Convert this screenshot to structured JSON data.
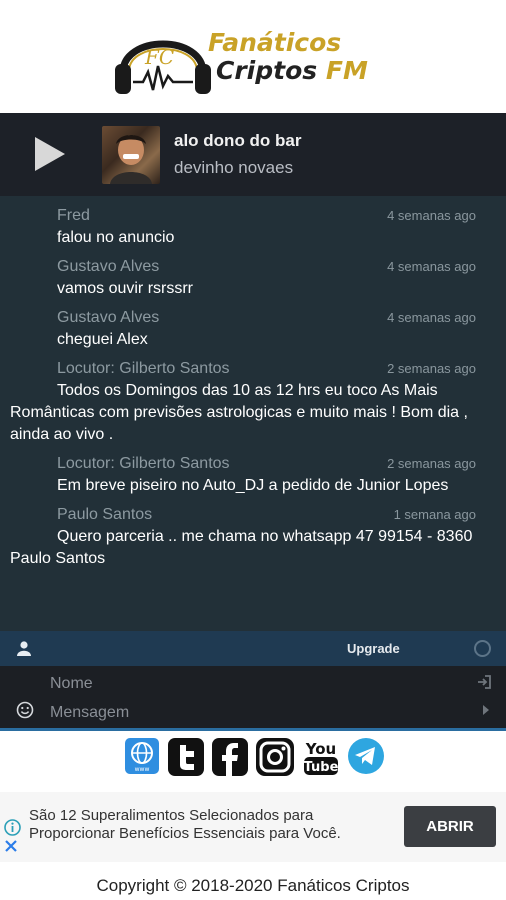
{
  "header": {
    "logo_line1": "Fanáticos",
    "logo_line2": "Criptos",
    "logo_fm": "FM",
    "logo_monogram": "FC"
  },
  "player": {
    "song_title": "alo dono do bar",
    "artist": "devinho novaes",
    "play_icon": "play-icon"
  },
  "chat": {
    "messages": [
      {
        "author": "Fred",
        "time": "4 semanas ago",
        "text": "falou no anuncio"
      },
      {
        "author": "Gustavo Alves",
        "time": "4 semanas ago",
        "text": "vamos ouvir rsrssrr"
      },
      {
        "author": "Gustavo Alves",
        "time": "4 semanas ago",
        "text": "cheguei Alex"
      },
      {
        "author": "Locutor: Gilberto Santos",
        "time": "2 semanas ago",
        "text": "Todos os Domingos das 10 as 12 hrs eu toco As Mais Românticas com previsões astrologicas e muito mais ! Bom dia , ainda ao vivo ."
      },
      {
        "author": "Locutor: Gilberto Santos",
        "time": "2 semanas ago",
        "text": "Em breve piseiro no Auto_DJ a pedido de Junior Lopes"
      },
      {
        "author": "Paulo Santos",
        "time": "1 semana ago",
        "text": "Quero parceria .. me chama no whatsapp 47 99154 - 8360 Paulo Santos"
      }
    ]
  },
  "chat_bar": {
    "upgrade_label": "Upgrade"
  },
  "form": {
    "name_placeholder": "Nome",
    "message_placeholder": "Mensagem"
  },
  "social": {
    "icons": [
      "globe-icon",
      "twitter-icon",
      "facebook-icon",
      "instagram-icon",
      "youtube-icon",
      "telegram-icon"
    ],
    "www_label": "www",
    "youtube_label_1": "You",
    "youtube_label_2": "Tube"
  },
  "ad": {
    "text": "São 12 Superalimentos Selecionados para Proporcionar Benefícios Essenciais para Você.",
    "button_label": "ABRIR"
  },
  "footer": {
    "copyright": "Copyright © 2018-2020 Fanáticos Criptos"
  },
  "colors": {
    "gold": "#c9a227",
    "player_bg": "#1d2128",
    "chat_bg": "#223038",
    "chat_bar_bg": "#1f3a52",
    "input_bg": "#1c1f24",
    "accent_blue": "#2a6da0"
  }
}
